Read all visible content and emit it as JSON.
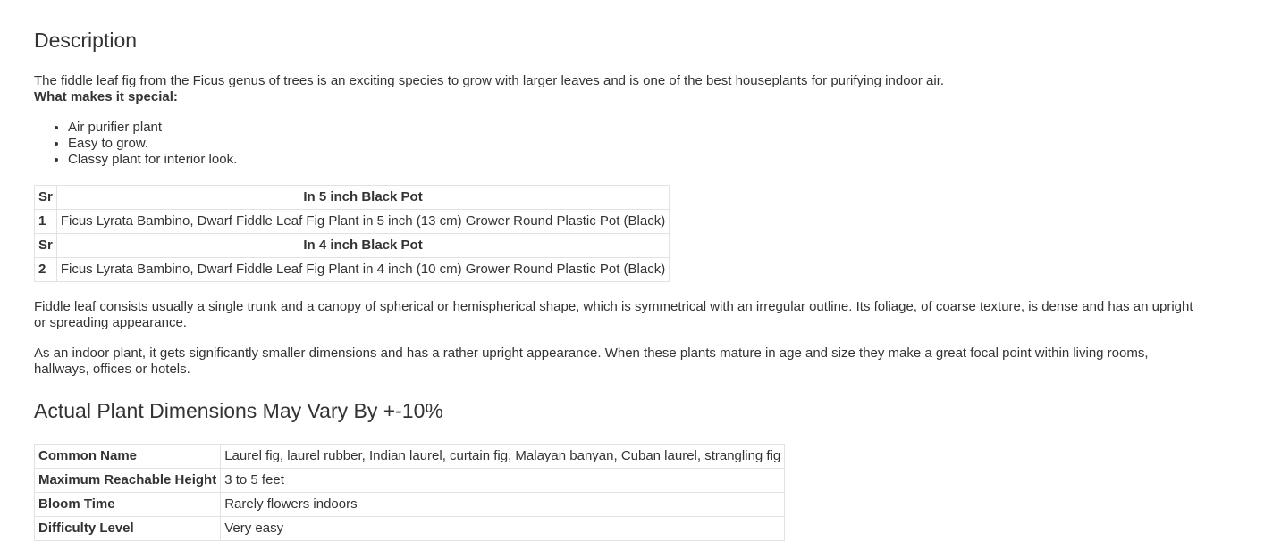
{
  "description": {
    "title": "Description",
    "intro": "The fiddle leaf fig from the Ficus genus of trees is an exciting species to grow with larger leaves and is one of the best houseplants for purifying indoor air.",
    "special_label": "What makes it special:",
    "features": [
      "Air purifier plant",
      "Easy to grow.",
      "Classy plant for interior look."
    ]
  },
  "pots_table": {
    "rows": [
      {
        "type": "header",
        "sr": "Sr",
        "label": "In 5 inch Black Pot"
      },
      {
        "type": "row",
        "sr": "1",
        "label": "Ficus Lyrata Bambino, Dwarf Fiddle Leaf Fig Plant in 5 inch (13 cm) Grower Round Plastic Pot (Black)"
      },
      {
        "type": "header",
        "sr": "Sr",
        "label": "In 4 inch Black Pot"
      },
      {
        "type": "row",
        "sr": "2",
        "label": "Ficus Lyrata Bambino, Dwarf Fiddle Leaf Fig Plant in 4 inch (10 cm) Grower Round Plastic Pot (Black)"
      }
    ]
  },
  "paragraphs": [
    "Fiddle leaf consists usually a single trunk and a canopy of spherical or hemispherical shape, which is symmetrical with an irregular outline. Its foliage, of coarse texture, is dense and has an upright or spreading appearance.",
    "As an indoor plant, it gets significantly smaller dimensions and has a rather upright appearance. When these plants mature in age and size they make a great focal point within living rooms, hallways, offices or hotels."
  ],
  "dimensions": {
    "title": "Actual Plant Dimensions May Vary By +-10%",
    "rows": [
      {
        "key": "Common Name",
        "value": "Laurel fig, laurel rubber, Indian laurel, curtain fig, Malayan banyan, Cuban laurel, strangling fig"
      },
      {
        "key": "Maximum Reachable Height",
        "value": "3 to 5 feet"
      },
      {
        "key": "Bloom Time",
        "value": "Rarely flowers indoors"
      },
      {
        "key": "Difficulty Level",
        "value": "Very easy"
      }
    ]
  }
}
